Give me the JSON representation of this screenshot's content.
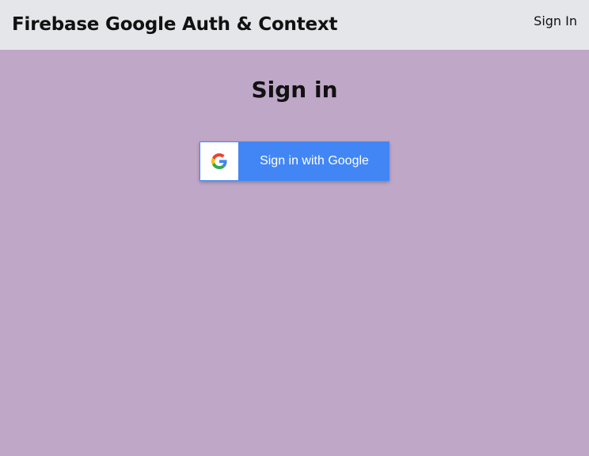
{
  "navbar": {
    "brand": "Firebase Google Auth & Context",
    "link_label": "Sign In",
    "background": "#e5e6ea"
  },
  "main": {
    "title": "Sign in",
    "background": "#bfa7c7",
    "google_button": {
      "label": "Sign in with Google",
      "icon": "google-g-logo",
      "color": "#4286f5"
    }
  }
}
